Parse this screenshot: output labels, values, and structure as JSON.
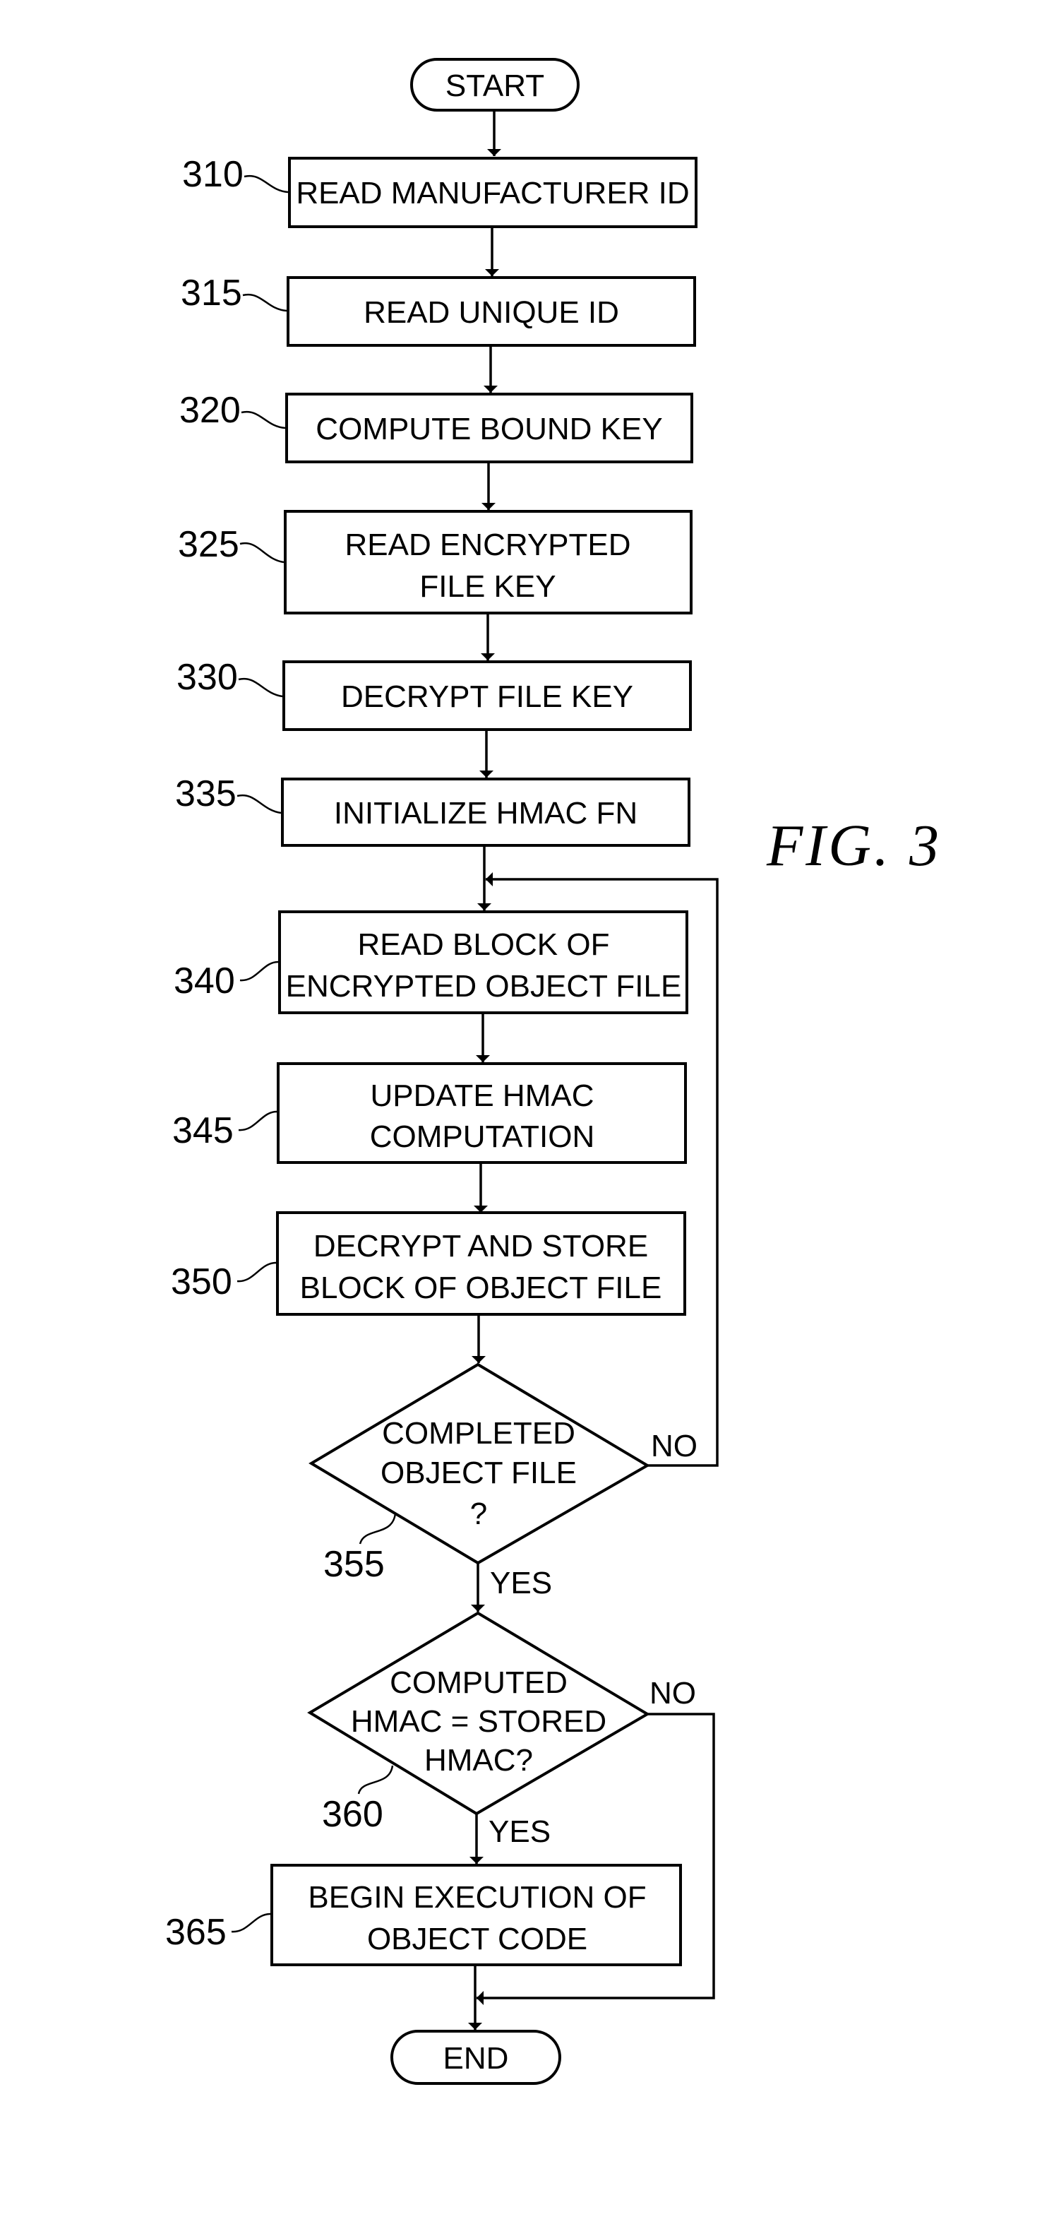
{
  "figure": {
    "title": "FIG. 3"
  },
  "terminals": {
    "start": "START",
    "end": "END"
  },
  "steps": [
    {
      "ref": "310",
      "lines": [
        "READ MANUFACTURER ID"
      ]
    },
    {
      "ref": "315",
      "lines": [
        "READ UNIQUE ID"
      ]
    },
    {
      "ref": "320",
      "lines": [
        "COMPUTE BOUND KEY"
      ]
    },
    {
      "ref": "325",
      "lines": [
        "READ ENCRYPTED",
        "FILE KEY"
      ]
    },
    {
      "ref": "330",
      "lines": [
        "DECRYPT FILE KEY"
      ]
    },
    {
      "ref": "335",
      "lines": [
        "INITIALIZE HMAC FN"
      ]
    },
    {
      "ref": "340",
      "lines": [
        "READ BLOCK OF",
        "ENCRYPTED OBJECT FILE"
      ]
    },
    {
      "ref": "345",
      "lines": [
        "UPDATE HMAC",
        "COMPUTATION"
      ]
    },
    {
      "ref": "350",
      "lines": [
        "DECRYPT AND STORE",
        "BLOCK OF OBJECT FILE"
      ]
    },
    {
      "ref": "365",
      "lines": [
        "BEGIN EXECUTION OF",
        "OBJECT CODE"
      ]
    }
  ],
  "decisions": [
    {
      "ref": "355",
      "lines": [
        "COMPLETED",
        "OBJECT FILE",
        "?"
      ],
      "yes_label": "YES",
      "no_label": "NO"
    },
    {
      "ref": "360",
      "lines": [
        "COMPUTED",
        "HMAC = STORED",
        "HMAC?"
      ],
      "yes_label": "YES",
      "no_label": "NO"
    }
  ]
}
